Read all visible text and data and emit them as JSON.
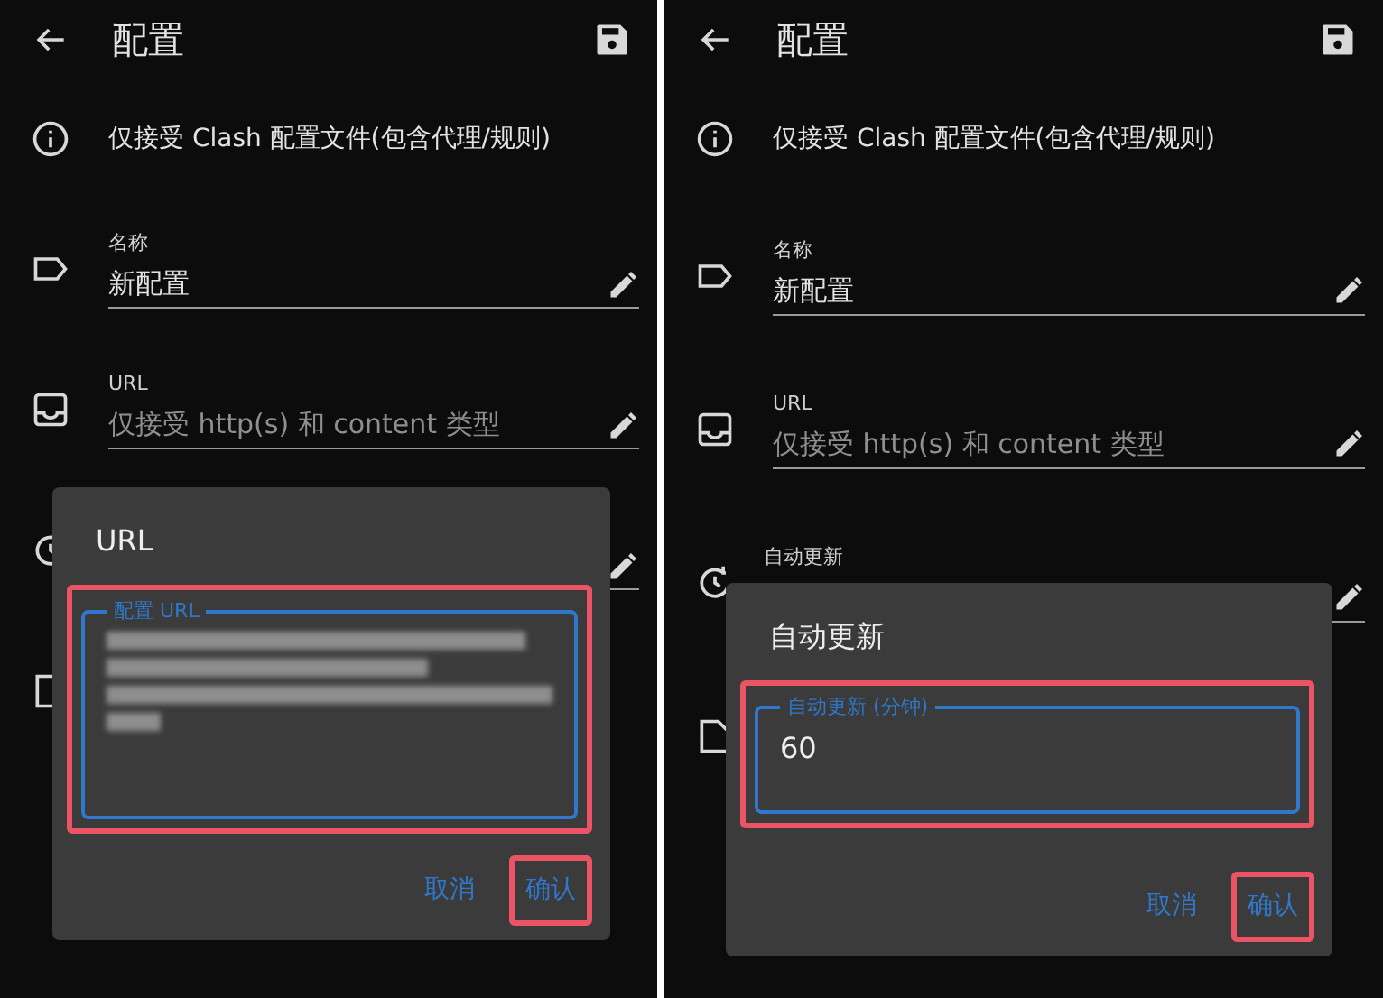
{
  "panels": [
    {
      "app_bar": {
        "title": "配置"
      },
      "notice": "仅接受 Clash 配置文件(包含代理/规则)",
      "rows": [
        {
          "kind": "name",
          "label": "名称",
          "value": "新配置"
        },
        {
          "kind": "url",
          "label": "URL",
          "placeholder": "仅接受 http(s) 和 content 类型"
        },
        {
          "kind": "schedule"
        },
        {
          "kind": "folder"
        }
      ],
      "dialog": {
        "title": "URL",
        "field": {
          "label": "配置 URL",
          "redacted": true,
          "highlighted": true
        },
        "buttons": [
          {
            "label": "取消",
            "highlighted": false
          },
          {
            "label": "确认",
            "highlighted": true
          }
        ]
      }
    },
    {
      "app_bar": {
        "title": "配置"
      },
      "notice": "仅接受 Clash 配置文件(包含代理/规则)",
      "rows": [
        {
          "kind": "name",
          "label": "名称",
          "value": "新配置"
        },
        {
          "kind": "url",
          "label": "URL",
          "placeholder": "仅接受 http(s) 和 content 类型"
        },
        {
          "kind": "schedule",
          "label": "自动更新"
        },
        {
          "kind": "folder"
        }
      ],
      "dialog": {
        "title": "自动更新",
        "field": {
          "label": "自动更新 (分钟)",
          "value": "60",
          "highlighted": true
        },
        "buttons": [
          {
            "label": "取消",
            "highlighted": false
          },
          {
            "label": "确认",
            "highlighted": true
          }
        ]
      }
    }
  ]
}
